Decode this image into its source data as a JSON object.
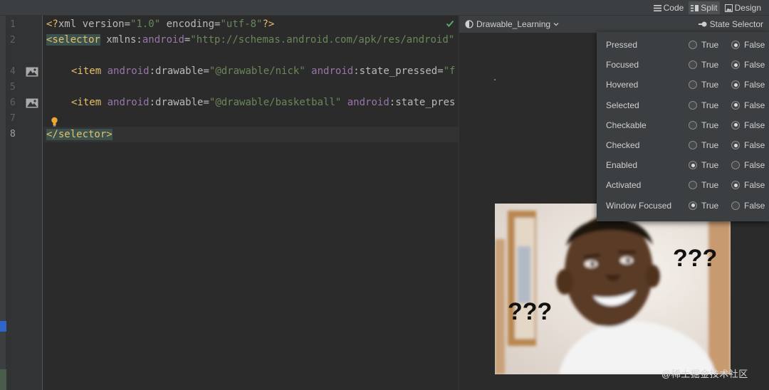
{
  "toolbar": {
    "modes": [
      {
        "label": "Code",
        "icon": "code-lines-icon",
        "active": false
      },
      {
        "label": "Split",
        "icon": "split-view-icon",
        "active": true
      },
      {
        "label": "Design",
        "icon": "image-icon",
        "active": false
      }
    ]
  },
  "editor": {
    "line_numbers": [
      "1",
      "2",
      "4",
      "5",
      "6",
      "7",
      "8"
    ],
    "current_line": "8",
    "code": {
      "l1_open": "<?",
      "l1_name": "xml",
      "l1_attr1": " version=",
      "l1_val1": "\"1.0\"",
      "l1_attr2": " encoding=",
      "l1_val2": "\"utf-8\"",
      "l1_close": "?>",
      "l2_tag": "<selector",
      "l2_attr": " xmlns:",
      "l2_ns": "android",
      "l2_eq": "=",
      "l2_val": "\"http://schemas.android.com/apk/res/android\"",
      "l4_tag": "<item",
      "l4_ns1": " android",
      "l4_attr1": ":drawable=",
      "l4_val1": "\"@drawable/nick\"",
      "l4_ns2": " android",
      "l4_attr2": ":state_pressed=",
      "l4_val2": "\"f",
      "l6_tag": "<item",
      "l6_ns1": " android",
      "l6_attr1": ":drawable=",
      "l6_val1": "\"@drawable/basketball\"",
      "l6_ns2": " android",
      "l6_attr2": ":state_pres",
      "l8_tag": "</selector>"
    }
  },
  "preview": {
    "theme_label": "Drawable_Learning",
    "state_selector_label": "State Selector",
    "meme_text_right": "???",
    "meme_text_left": "???"
  },
  "state_selector": {
    "true_label": "True",
    "false_label": "False",
    "states": [
      {
        "name": "Pressed",
        "value": false
      },
      {
        "name": "Focused",
        "value": false
      },
      {
        "name": "Hovered",
        "value": false
      },
      {
        "name": "Selected",
        "value": false
      },
      {
        "name": "Checkable",
        "value": false
      },
      {
        "name": "Checked",
        "value": false
      },
      {
        "name": "Enabled",
        "value": true
      },
      {
        "name": "Activated",
        "value": false
      },
      {
        "name": "Window Focused",
        "value": true
      }
    ]
  },
  "watermark": "@稀土掘金技术社区",
  "colors": {
    "tag": "#e8bf6a",
    "string": "#6a8759",
    "namespace": "#9876aa"
  }
}
